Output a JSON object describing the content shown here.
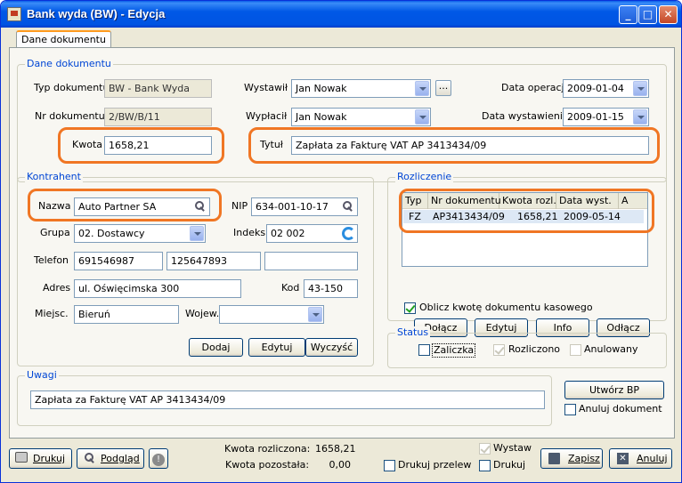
{
  "window": {
    "title": "Bank wyda (BW) - Edycja"
  },
  "tabs": [
    "Dane dokumentu"
  ],
  "doc": {
    "section": "Dane dokumentu",
    "typ_label": "Typ dokumentu",
    "typ_value": "BW - Bank Wyda",
    "nr_label": "Nr dokumentu",
    "nr_value": "2/BW/B/11",
    "kwota_label": "Kwota",
    "kwota_value": "1658,21",
    "wystawil_label": "Wystawił",
    "wystawil_value": "Jan Nowak",
    "wyplacil_label": "Wypłacił",
    "wyplacil_value": "Jan Nowak",
    "tytul_label": "Tytuł",
    "tytul_value": "Zapłata za Fakturę VAT AP 3413434/09",
    "data_operacji_label": "Data operacji",
    "data_operacji_value": "2009-01-04",
    "data_wystawienia_label": "Data wystawienia",
    "data_wystawienia_value": "2009-01-15",
    "ellipsis": "..."
  },
  "kontrahent": {
    "section": "Kontrahent",
    "nazwa_label": "Nazwa",
    "nazwa_value": "Auto Partner SA",
    "nip_label": "NIP",
    "nip_value": "634-001-10-17",
    "grupa_label": "Grupa",
    "grupa_value": "02. Dostawcy",
    "indeks_label": "Indeks",
    "indeks_value": "02 002",
    "telefon_label": "Telefon",
    "telefon1": "691546987",
    "telefon2": "125647893",
    "telefon3": "",
    "adres_label": "Adres",
    "adres_value": "ul. Oświęcimska 300",
    "kod_label": "Kod",
    "kod_value": "43-150",
    "miejsc_label": "Miejsc.",
    "miejsc_value": "Bieruń",
    "wojew_label": "Wojew.",
    "wojew_value": "",
    "dodaj": "Dodaj",
    "edytuj": "Edytuj",
    "wyczysc": "Wyczyść"
  },
  "rozliczenie": {
    "section": "Rozliczenie",
    "columns": [
      "Typ",
      "Nr dokumentu",
      "Kwota rozl.",
      "Data wyst.",
      "A"
    ],
    "rows": [
      {
        "typ": "FZ",
        "nr": "AP3413434/09",
        "kwota": "1658,21",
        "data": "2009-05-14",
        "a": ""
      }
    ],
    "oblicz_label": "Oblicz kwotę dokumentu kasowego",
    "dolacz": "Dołącz",
    "edytuj": "Edytuj",
    "info": "Info",
    "odlacz": "Odłącz"
  },
  "status": {
    "section": "Status",
    "zaliczka": "Zaliczka",
    "rozliczono": "Rozliczono",
    "anulowany": "Anulowany"
  },
  "uwagi": {
    "section": "Uwagi",
    "value": "Zapłata za Fakturę VAT AP 3413434/09",
    "utworz_bp": "Utwórz BP",
    "anuluj_dokument": "Anuluj dokument"
  },
  "footer": {
    "drukuj": "Drukuj",
    "podglad": "Podgląd",
    "kwota_rozliczona_label": "Kwota rozliczona:",
    "kwota_rozliczona_value": "1658,21",
    "kwota_pozostala_label": "Kwota pozostała:",
    "kwota_pozostala_value": "0,00",
    "wystaw": "Wystaw",
    "drukuj_przelew": "Drukuj przelew",
    "drukuj_cb": "Drukuj",
    "zapisz": "Zapisz",
    "anuluj": "Anuluj"
  }
}
